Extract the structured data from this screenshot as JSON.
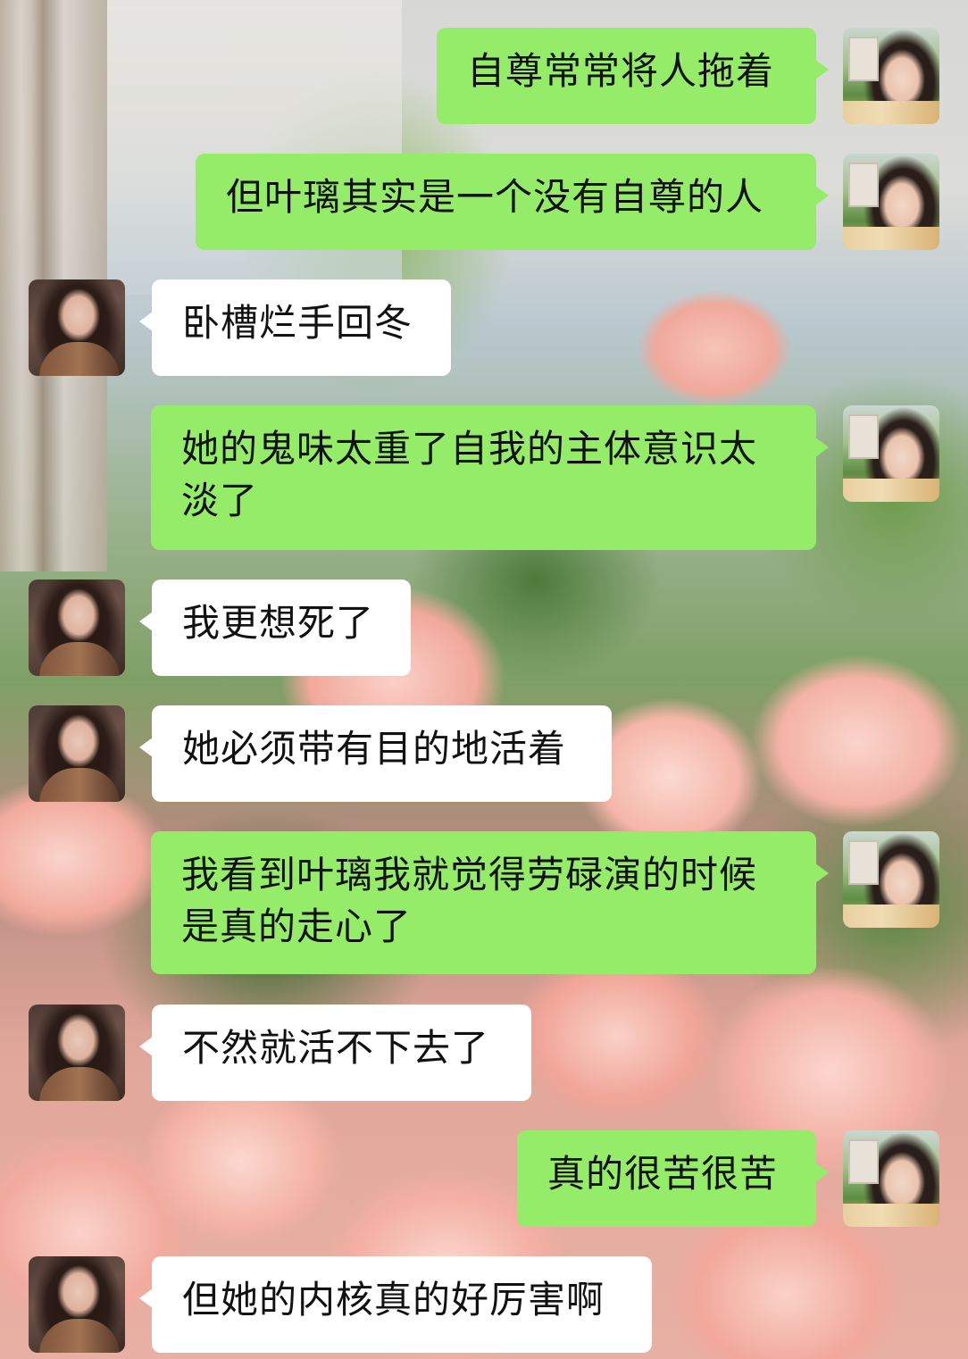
{
  "messages": [
    {
      "side": "sent",
      "text": "自尊常常将人拖着"
    },
    {
      "side": "sent",
      "text": "但叶璃其实是一个没有自尊的人"
    },
    {
      "side": "recv",
      "text": "卧槽烂手回冬"
    },
    {
      "side": "sent",
      "text": "她的鬼味太重了自我的主体意识太\n淡了"
    },
    {
      "side": "recv",
      "text": "我更想死了"
    },
    {
      "side": "recv",
      "text": "她必须带有目的地活着"
    },
    {
      "side": "sent",
      "text": "我看到叶璃我就觉得劳碌演的时候\n是真的走心了"
    },
    {
      "side": "recv",
      "text": "不然就活不下去了"
    },
    {
      "side": "sent",
      "text": "真的很苦很苦"
    },
    {
      "side": "recv",
      "text": "但她的内核真的好厉害啊"
    }
  ],
  "colors": {
    "sent_bubble": "#95ec69",
    "recv_bubble": "#ffffff",
    "text": "#111111"
  },
  "icons": {
    "me_avatar": "user-avatar",
    "contact_avatar": "contact-avatar"
  }
}
